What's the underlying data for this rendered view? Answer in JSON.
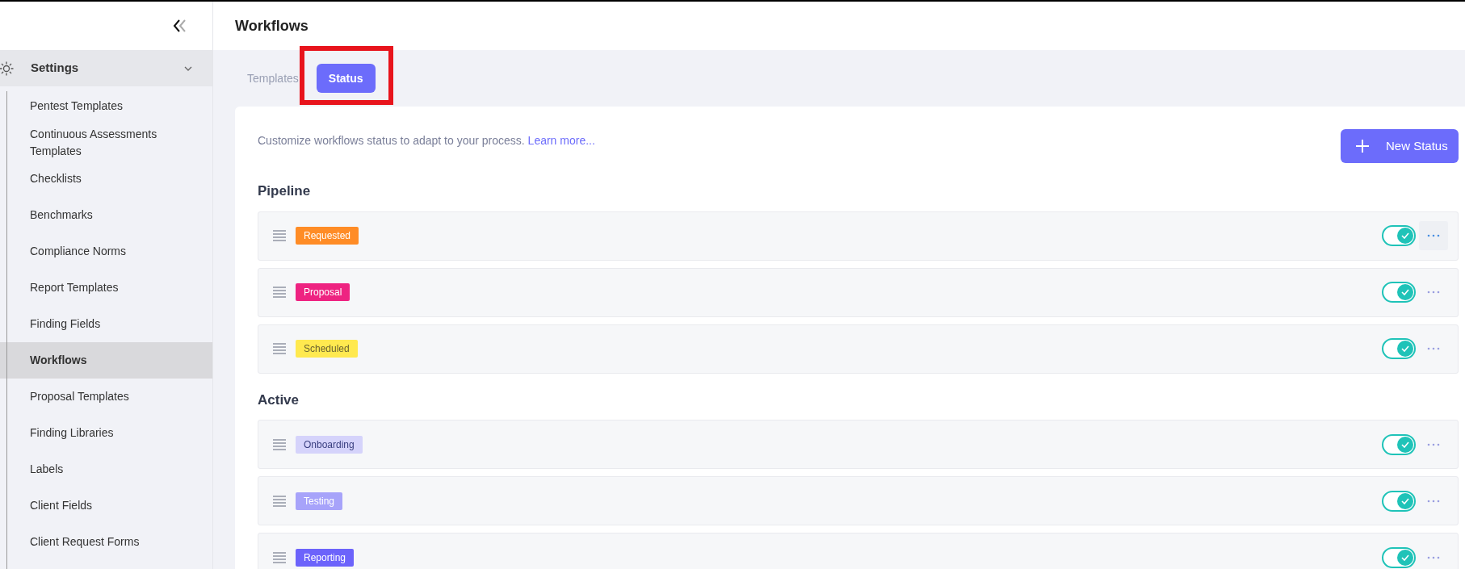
{
  "page_title": "Workflows",
  "sidebar": {
    "section": {
      "label": "Settings",
      "expanded": true
    },
    "items": [
      {
        "label": "Pentest Templates",
        "selected": false
      },
      {
        "label": "Continuous Assessments Templates",
        "selected": false
      },
      {
        "label": "Checklists",
        "selected": false
      },
      {
        "label": "Benchmarks",
        "selected": false
      },
      {
        "label": "Compliance Norms",
        "selected": false
      },
      {
        "label": "Report Templates",
        "selected": false
      },
      {
        "label": "Finding Fields",
        "selected": false
      },
      {
        "label": "Workflows",
        "selected": true
      },
      {
        "label": "Proposal Templates",
        "selected": false
      },
      {
        "label": "Finding Libraries",
        "selected": false
      },
      {
        "label": "Labels",
        "selected": false
      },
      {
        "label": "Client Fields",
        "selected": false
      },
      {
        "label": "Client Request Forms",
        "selected": false
      }
    ]
  },
  "tabs": [
    {
      "label": "Templates",
      "selected": false
    },
    {
      "label": "Status",
      "selected": true,
      "highlighted": true
    }
  ],
  "description": {
    "text": "Customize workflows status to adapt to your process.",
    "link": "Learn more..."
  },
  "new_button": "New Status",
  "groups": [
    {
      "title": "Pipeline",
      "statuses": [
        {
          "label": "Requested",
          "color": "#ff8c26",
          "on": true,
          "menu_highlighted": true
        },
        {
          "label": "Proposal",
          "color": "#ee2381",
          "on": true,
          "menu_highlighted": false
        },
        {
          "label": "Scheduled",
          "color": "#ffe94f",
          "on": true,
          "menu_highlighted": false
        }
      ]
    },
    {
      "title": "Active",
      "statuses": [
        {
          "label": "Onboarding",
          "color": "#d5d3fb",
          "on": true,
          "menu_highlighted": false
        },
        {
          "label": "Testing",
          "color": "#a7a3fa",
          "on": true,
          "menu_highlighted": false
        },
        {
          "label": "Reporting",
          "color": "#6c63fb",
          "on": true,
          "menu_highlighted": false
        }
      ]
    }
  ]
}
